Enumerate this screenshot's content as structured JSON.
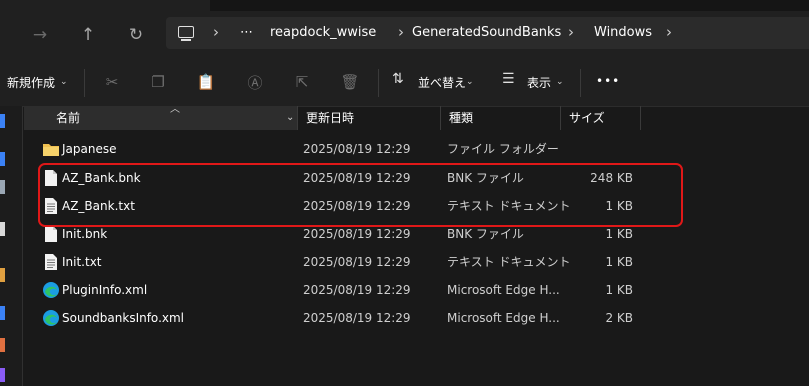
{
  "breadcrumb": {
    "items": [
      "reapdock_wwise",
      "GeneratedSoundBanks",
      "Windows"
    ],
    "more": "⋯"
  },
  "toolbar": {
    "new_label": "新規作成",
    "sort_label": "並べ替え",
    "view_label": "表示",
    "more": "•••"
  },
  "columns": {
    "name": "名前",
    "date": "更新日時",
    "type": "種類",
    "size": "サイズ"
  },
  "files": [
    {
      "name": "Japanese",
      "date": "2025/08/19 12:29",
      "type": "ファイル フォルダー",
      "size": "",
      "icon": "folder-icon"
    },
    {
      "name": "AZ_Bank.bnk",
      "date": "2025/08/19 12:29",
      "type": "BNK ファイル",
      "size": "248 KB",
      "icon": "file-icon"
    },
    {
      "name": "AZ_Bank.txt",
      "date": "2025/08/19 12:29",
      "type": "テキスト ドキュメント",
      "size": "1 KB",
      "icon": "text-file-icon"
    },
    {
      "name": "Init.bnk",
      "date": "2025/08/19 12:29",
      "type": "BNK ファイル",
      "size": "1 KB",
      "icon": "file-icon"
    },
    {
      "name": "Init.txt",
      "date": "2025/08/19 12:29",
      "type": "テキスト ドキュメント",
      "size": "1 KB",
      "icon": "text-file-icon"
    },
    {
      "name": "PluginInfo.xml",
      "date": "2025/08/19 12:29",
      "type": "Microsoft Edge H...",
      "size": "1 KB",
      "icon": "edge-icon"
    },
    {
      "name": "SoundbanksInfo.xml",
      "date": "2025/08/19 12:29",
      "type": "Microsoft Edge H...",
      "size": "2 KB",
      "icon": "edge-icon"
    }
  ],
  "colors": {
    "background": "#191919",
    "toolbar": "#202020",
    "highlight": "#e01818",
    "folder": "#f0c050",
    "edge": "#1b9de2"
  }
}
